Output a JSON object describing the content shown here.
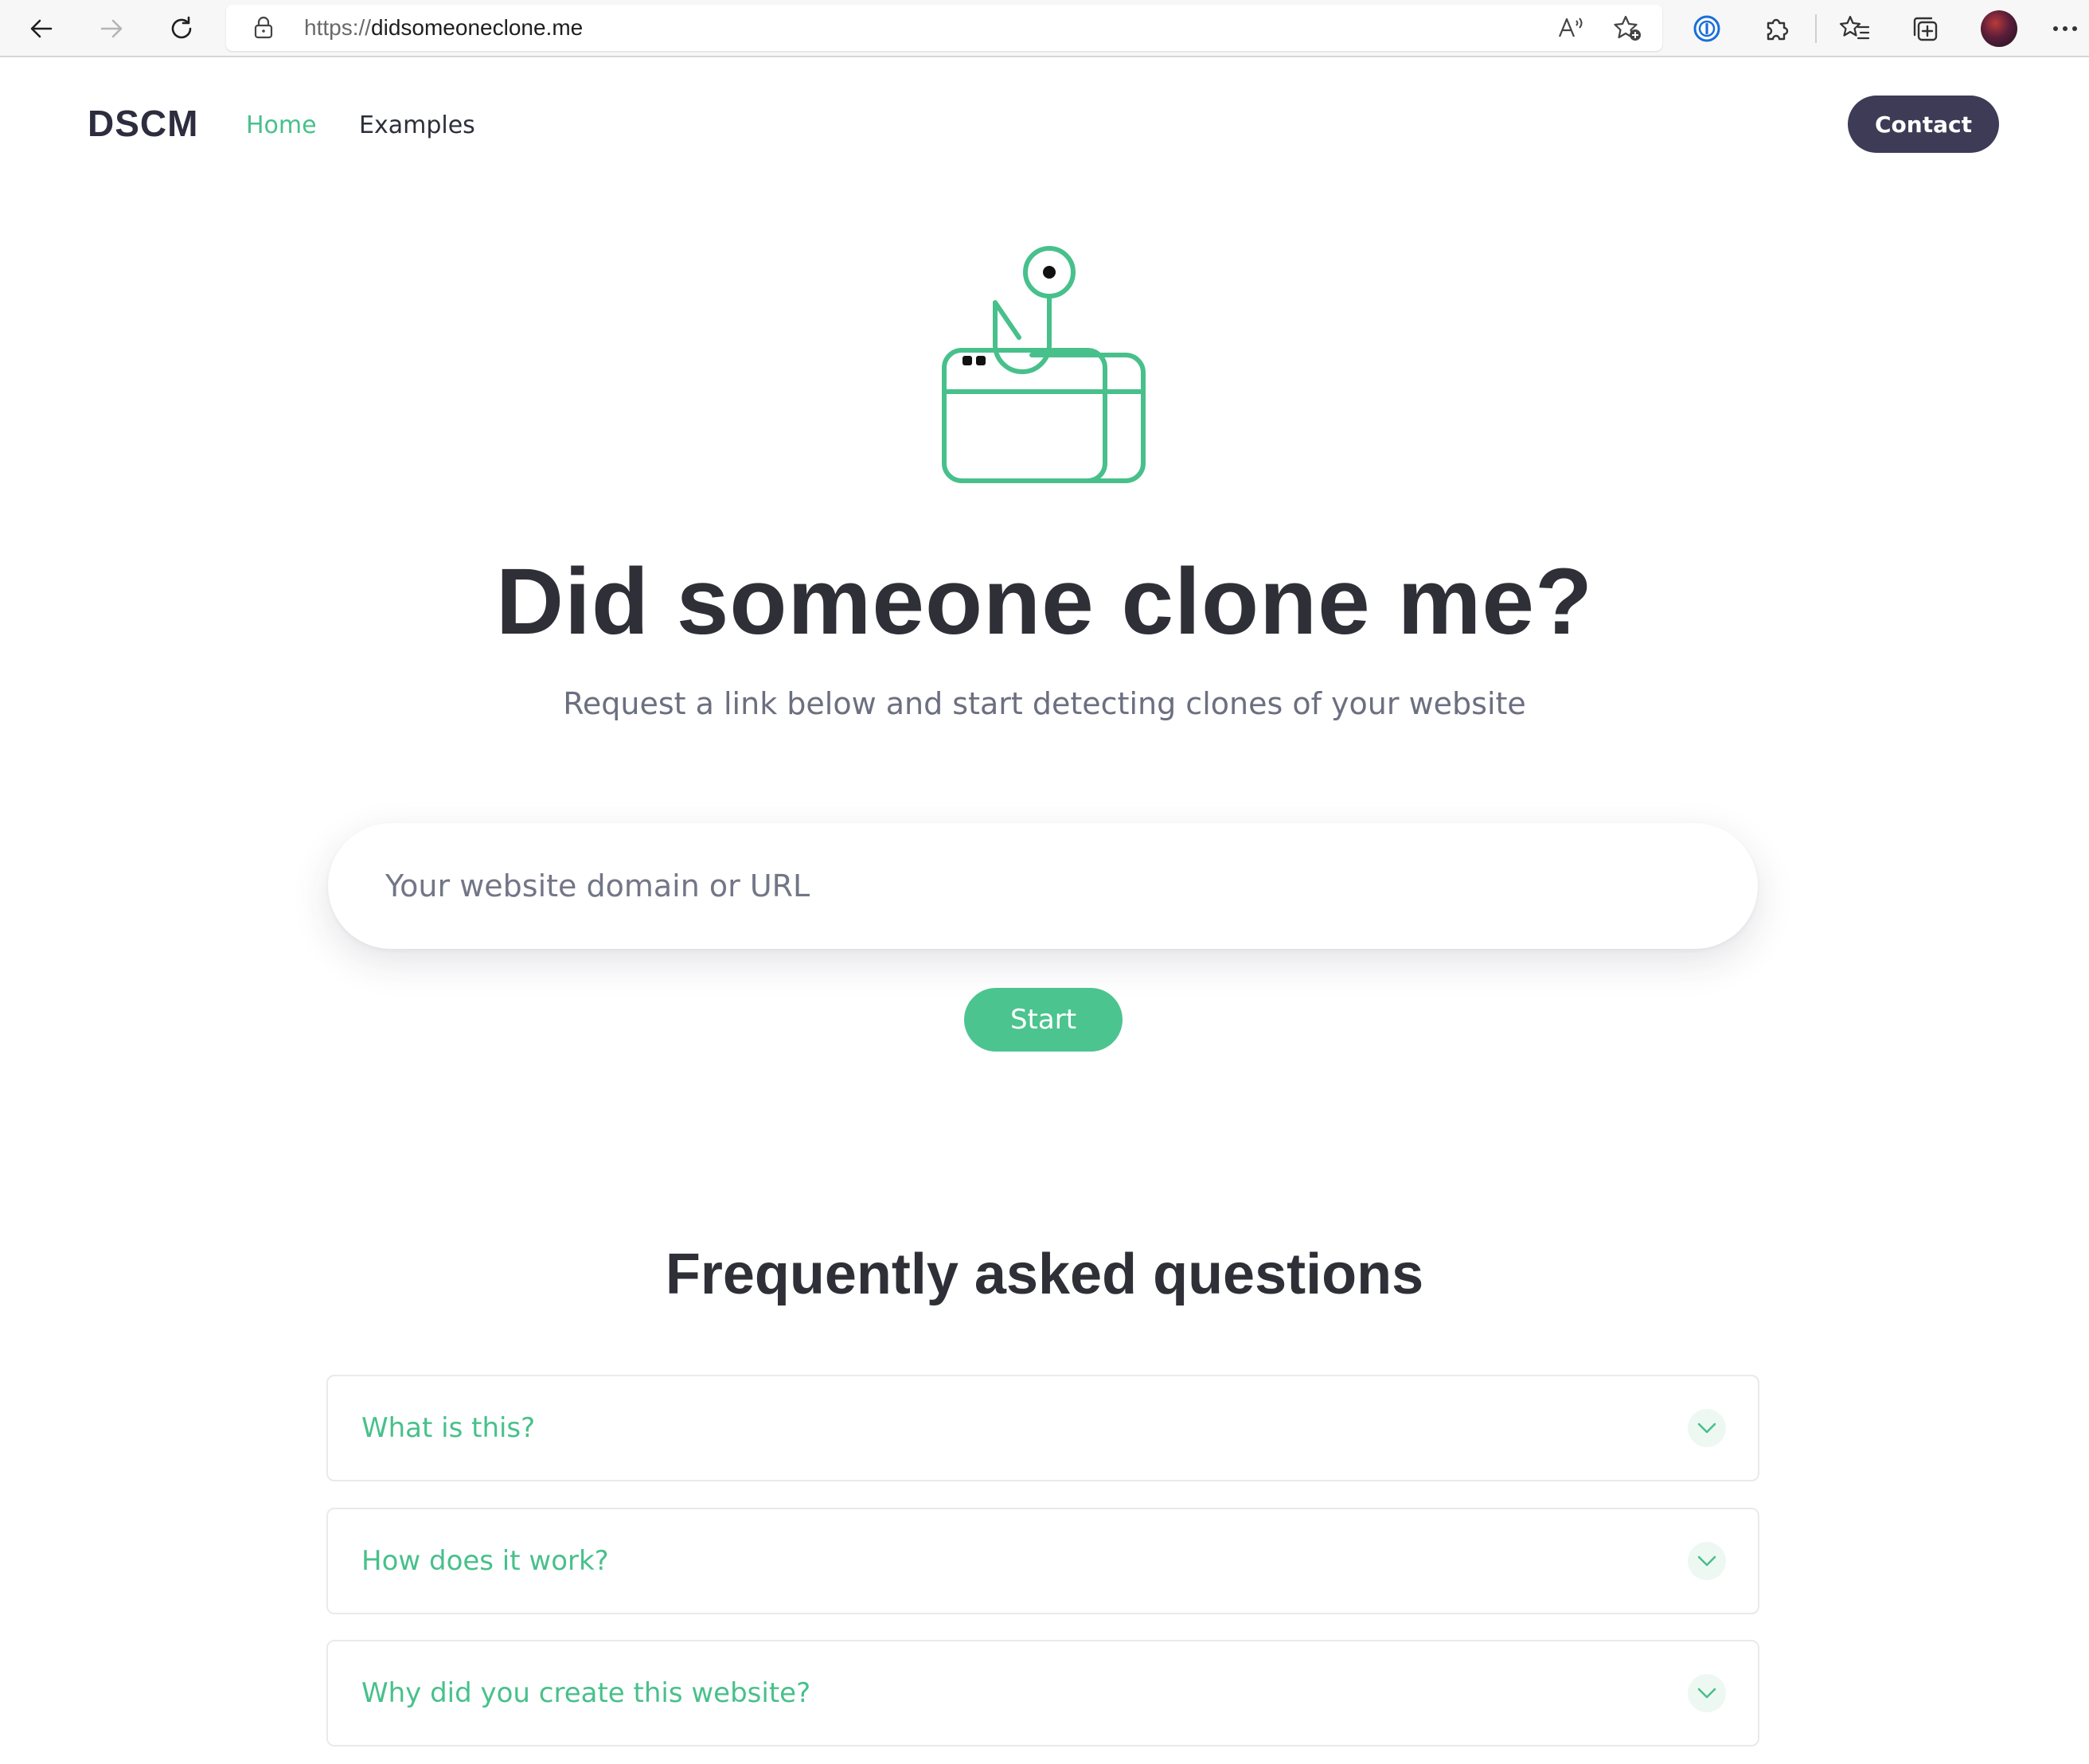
{
  "browser": {
    "url_scheme": "https://",
    "url_host": "didsomeoneclone.me"
  },
  "header": {
    "logo": "DSCM",
    "nav": [
      {
        "label": "Home",
        "active": true
      },
      {
        "label": "Examples",
        "active": false
      }
    ],
    "contact_label": "Contact"
  },
  "hero": {
    "title": "Did someone clone me?",
    "subtitle": "Request a link below and start detecting clones of your website",
    "input_placeholder": "Your website domain or URL",
    "start_label": "Start"
  },
  "faq": {
    "title": "Frequently asked questions",
    "items": [
      {
        "question": "What is this?"
      },
      {
        "question": "How does it work?"
      },
      {
        "question": "Why did you create this website?"
      }
    ]
  },
  "colors": {
    "accent_green": "#48c08b",
    "contact_bg": "#3d3b56",
    "text_dark": "#2f2f37"
  },
  "icons": [
    "back-arrow-icon",
    "forward-arrow-icon",
    "refresh-icon",
    "lock-icon",
    "read-aloud-icon",
    "add-favorite-icon",
    "password-manager-icon",
    "extensions-icon",
    "favorites-icon",
    "collections-icon",
    "profile-avatar",
    "more-menu-icon",
    "fishing-hook-browser-icon",
    "chevron-down-icon"
  ]
}
